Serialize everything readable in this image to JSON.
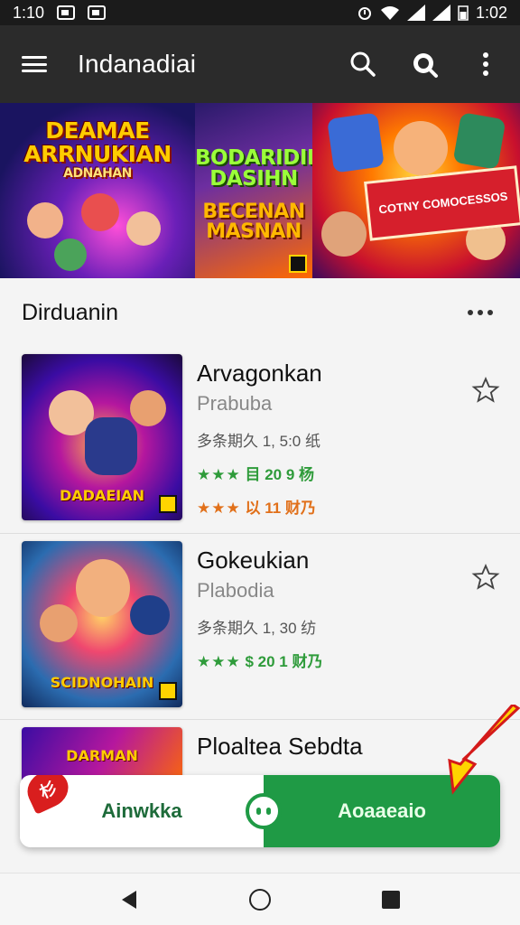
{
  "status_bar": {
    "time": "1:10",
    "battery_text": "1:02"
  },
  "app_bar": {
    "title": "Indanadiai",
    "icons": [
      "menu-icon",
      "search-icon",
      "search-alt-icon",
      "more-vertical-icon"
    ]
  },
  "banner": {
    "panel1_title": "DEAMAE ARRNUKIAN",
    "panel1_sub": "ADNAHAN",
    "panel2_top": "BODARIDIN DASIHN",
    "panel2_bottom": "BECENAN MASNAN",
    "panel3_sign": "COTNY COMOCESSOS"
  },
  "section": {
    "title": "Dirduanin"
  },
  "items": [
    {
      "title": "Arvagonkan",
      "subtitle": "Prabuba",
      "meta": "多条期久 1, 5:0 纸",
      "rating1_stars": "★★★",
      "rating1_text": "目 20 9 杨",
      "rating2_stars": "★★★",
      "rating2_text": "以 11 财乃",
      "thumb_label": "DADAEIAN"
    },
    {
      "title": "Gokeukian",
      "subtitle": "Plabodia",
      "meta": "多条期久 1, 30 纺",
      "rating1_stars": "★★★",
      "rating1_text": "$ 20 1 财乃",
      "thumb_label": "SCIDNOHAIN"
    },
    {
      "title": "Ploaltea Sebdta",
      "thumb_label": "DARMAN"
    }
  ],
  "cta": {
    "left_label": "Ainwkka",
    "right_label": "Aoaaeaio",
    "badge": "杉"
  },
  "colors": {
    "app_bar": "#2b2b2b",
    "accent_green": "#1f9a45",
    "rating_green": "#2e9b3a",
    "rating_orange": "#e1701a"
  }
}
